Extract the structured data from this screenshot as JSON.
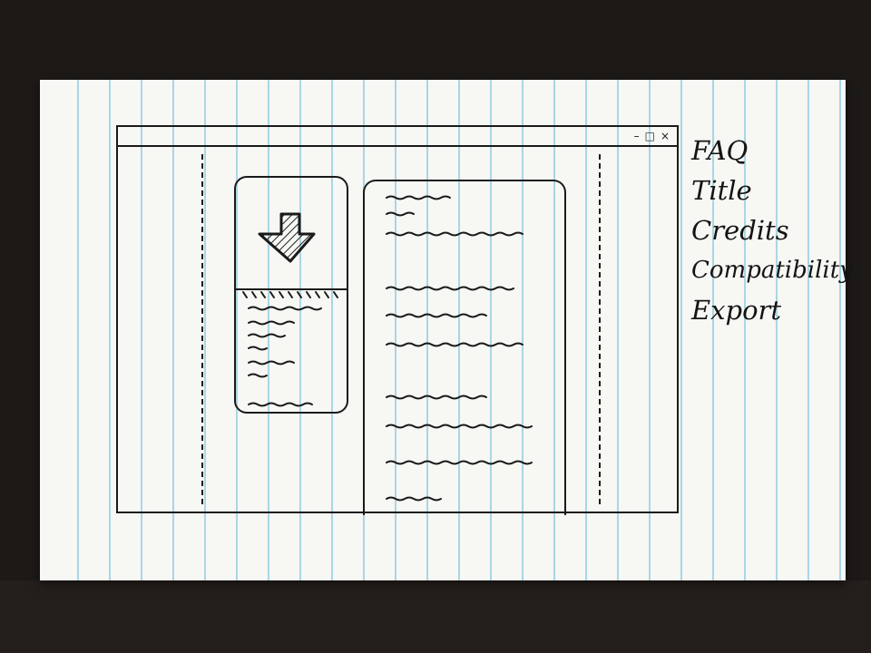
{
  "window": {
    "controls": {
      "minimize": "–",
      "maximize": "□",
      "close": "×"
    }
  },
  "download_card": {
    "icon": "download-arrow-icon"
  },
  "side_menu": {
    "items": [
      "FAQ",
      "Title",
      "Credits",
      "Compatibility",
      "Export"
    ]
  }
}
